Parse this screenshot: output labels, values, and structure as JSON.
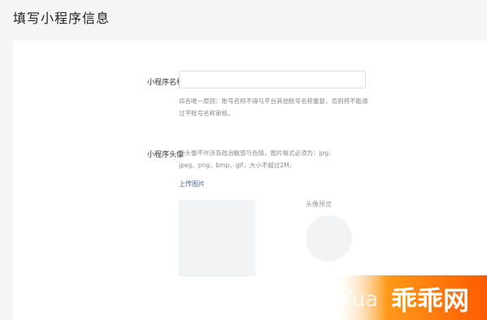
{
  "page": {
    "title": "填写小程序信息"
  },
  "form": {
    "name_label": "小程序名称",
    "name_value": "",
    "name_placeholder": "",
    "name_hint": "命名唯一原则：账号名称不得与平台其他账号名称重复，否则将不能通过平账号名称审核。",
    "avatar_label": "小程序头像",
    "avatar_hint": "新头像不许涉及政治敏感与色情，图片格式必须为：jpg、jpeg、png、bmp、gif，大小不超过2M。",
    "upload_link": "上传图片",
    "preview_label": "头像预览"
  },
  "watermark": {
    "text": "Kua 乖乖网"
  }
}
